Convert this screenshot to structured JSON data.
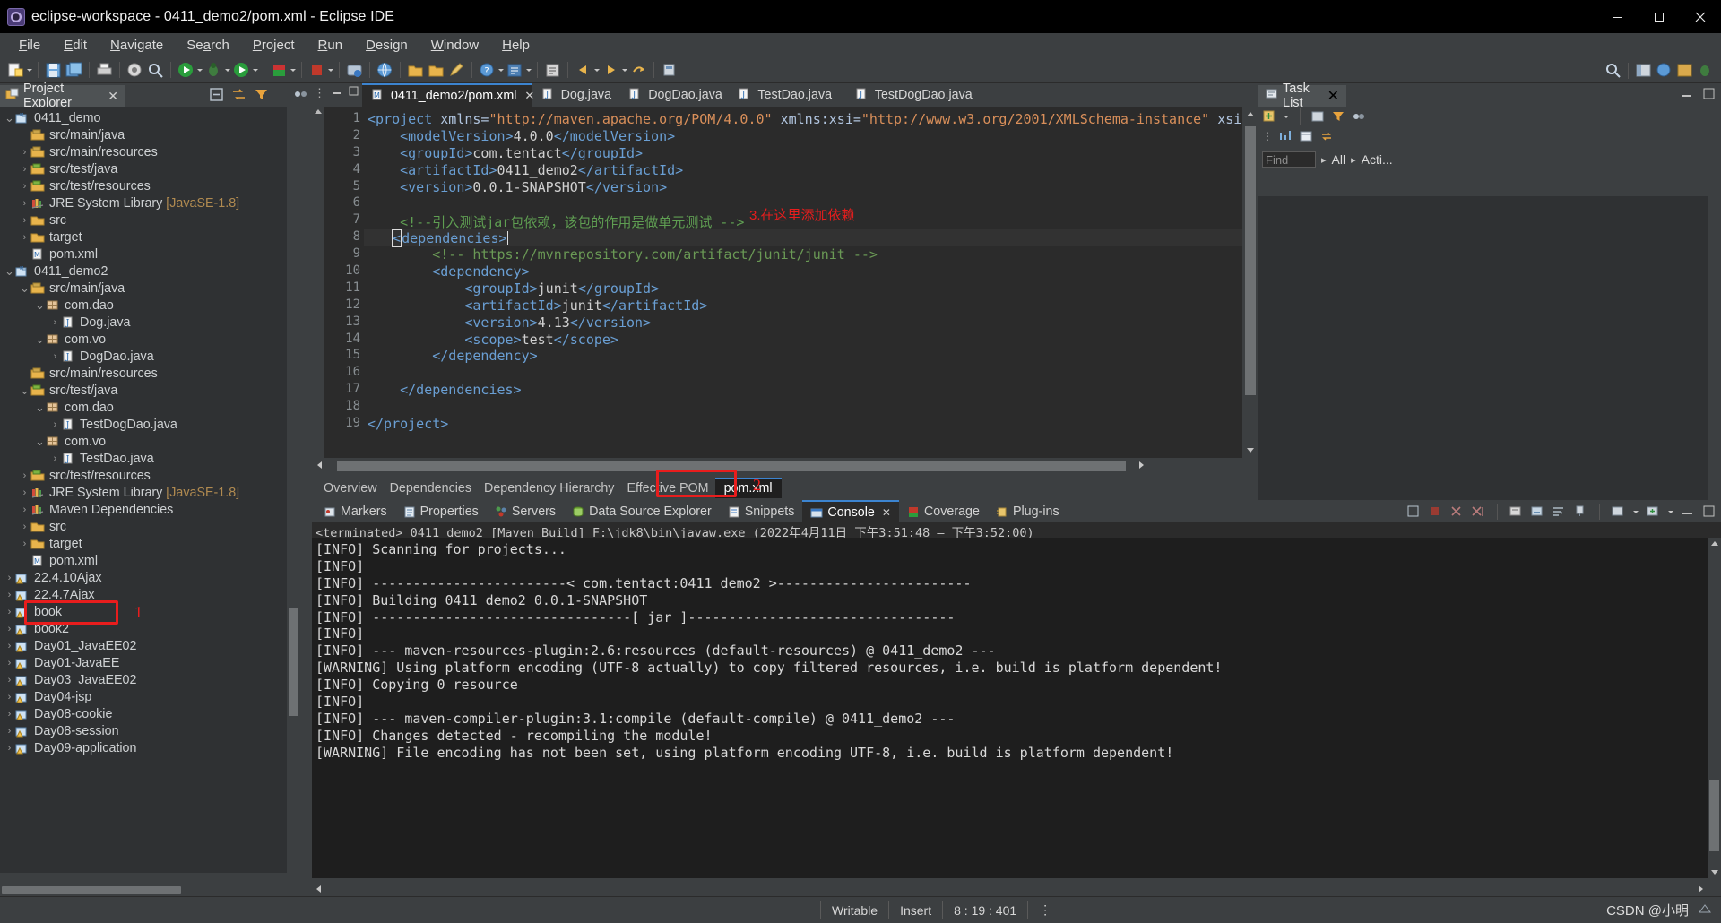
{
  "window": {
    "title": "eclipse-workspace - 0411_demo2/pom.xml - Eclipse IDE",
    "app_icon": "eclipse-icon",
    "minimize": "—",
    "maximize": "❐",
    "close": "✕"
  },
  "menubar": {
    "items": [
      {
        "label": "File",
        "mnemonic": "F"
      },
      {
        "label": "Edit",
        "mnemonic": "E"
      },
      {
        "label": "Navigate",
        "mnemonic": "N"
      },
      {
        "label": "Search",
        "mnemonic": "a"
      },
      {
        "label": "Project",
        "mnemonic": "P"
      },
      {
        "label": "Run",
        "mnemonic": "R"
      },
      {
        "label": "Design",
        "mnemonic": "D"
      },
      {
        "label": "Window",
        "mnemonic": "W"
      },
      {
        "label": "Help",
        "mnemonic": "H"
      }
    ]
  },
  "project_explorer": {
    "title": "Project Explorer",
    "close_label": "✕",
    "tools": [
      "collapse-all-icon",
      "link-with-editor-icon",
      "view-filter-icon",
      "view-menu-icon"
    ],
    "tree": [
      {
        "indent": 0,
        "twisty": "down",
        "icon": "maven-project-icon",
        "label": "0411_demo"
      },
      {
        "indent": 1,
        "twisty": "none",
        "icon": "source-folder-icon",
        "label": "src/main/java"
      },
      {
        "indent": 1,
        "twisty": "right",
        "icon": "source-folder-icon",
        "label": "src/main/resources"
      },
      {
        "indent": 1,
        "twisty": "right",
        "icon": "test-source-folder-icon",
        "label": "src/test/java"
      },
      {
        "indent": 1,
        "twisty": "right",
        "icon": "test-source-folder-icon",
        "label": "src/test/resources"
      },
      {
        "indent": 1,
        "twisty": "right",
        "icon": "library-icon",
        "label": "JRE System Library",
        "suffix": "[JavaSE-1.8]"
      },
      {
        "indent": 1,
        "twisty": "right",
        "icon": "folder-icon",
        "label": "src"
      },
      {
        "indent": 1,
        "twisty": "right",
        "icon": "folder-icon",
        "label": "target"
      },
      {
        "indent": 1,
        "twisty": "none",
        "icon": "maven-pom-icon",
        "label": "pom.xml"
      },
      {
        "indent": 0,
        "twisty": "down",
        "icon": "maven-project-icon",
        "label": "0411_demo2"
      },
      {
        "indent": 1,
        "twisty": "down",
        "icon": "source-folder-icon",
        "label": "src/main/java"
      },
      {
        "indent": 2,
        "twisty": "down",
        "icon": "package-icon",
        "label": "com.dao"
      },
      {
        "indent": 3,
        "twisty": "right",
        "icon": "java-file-icon",
        "label": "Dog.java"
      },
      {
        "indent": 2,
        "twisty": "down",
        "icon": "package-icon",
        "label": "com.vo"
      },
      {
        "indent": 3,
        "twisty": "right",
        "icon": "java-file-icon",
        "label": "DogDao.java"
      },
      {
        "indent": 1,
        "twisty": "none",
        "icon": "source-folder-icon",
        "label": "src/main/resources"
      },
      {
        "indent": 1,
        "twisty": "down",
        "icon": "test-source-folder-icon",
        "label": "src/test/java"
      },
      {
        "indent": 2,
        "twisty": "down",
        "icon": "package-icon",
        "label": "com.dao"
      },
      {
        "indent": 3,
        "twisty": "right",
        "icon": "java-file-icon",
        "label": "TestDogDao.java"
      },
      {
        "indent": 2,
        "twisty": "down",
        "icon": "package-icon",
        "label": "com.vo"
      },
      {
        "indent": 3,
        "twisty": "right",
        "icon": "java-file-icon",
        "label": "TestDao.java"
      },
      {
        "indent": 1,
        "twisty": "right",
        "icon": "test-source-folder-icon",
        "label": "src/test/resources"
      },
      {
        "indent": 1,
        "twisty": "right",
        "icon": "library-icon",
        "label": "JRE System Library",
        "suffix": "[JavaSE-1.8]"
      },
      {
        "indent": 1,
        "twisty": "right",
        "icon": "library-icon",
        "label": "Maven Dependencies"
      },
      {
        "indent": 1,
        "twisty": "right",
        "icon": "folder-icon",
        "label": "src"
      },
      {
        "indent": 1,
        "twisty": "right",
        "icon": "folder-icon",
        "label": "target"
      },
      {
        "indent": 1,
        "twisty": "none",
        "icon": "maven-pom-icon",
        "label": "pom.xml",
        "highlighted": true
      },
      {
        "indent": 0,
        "twisty": "right",
        "icon": "warn-project-icon",
        "label": "22.4.10Ajax"
      },
      {
        "indent": 0,
        "twisty": "right",
        "icon": "warn-project-icon",
        "label": "22.4.7Ajax"
      },
      {
        "indent": 0,
        "twisty": "right",
        "icon": "warn-project-icon",
        "label": "book"
      },
      {
        "indent": 0,
        "twisty": "right",
        "icon": "warn-project-icon",
        "label": "book2"
      },
      {
        "indent": 0,
        "twisty": "right",
        "icon": "warn-project-icon",
        "label": "Day01_JavaEE02"
      },
      {
        "indent": 0,
        "twisty": "right",
        "icon": "warn-project-icon",
        "label": "Day01-JavaEE"
      },
      {
        "indent": 0,
        "twisty": "right",
        "icon": "warn-project-icon",
        "label": "Day03_JavaEE02"
      },
      {
        "indent": 0,
        "twisty": "right",
        "icon": "warn-project-icon",
        "label": "Day04-jsp"
      },
      {
        "indent": 0,
        "twisty": "right",
        "icon": "warn-project-icon",
        "label": "Day08-cookie"
      },
      {
        "indent": 0,
        "twisty": "right",
        "icon": "warn-project-icon",
        "label": "Day08-session"
      },
      {
        "indent": 0,
        "twisty": "right",
        "icon": "warn-project-icon",
        "label": "Day09-application"
      }
    ]
  },
  "annotations": {
    "one": "1",
    "two": "2",
    "three": "3.在这里添加依赖"
  },
  "editor": {
    "tabs": [
      {
        "label": "0411_demo2/pom.xml",
        "icon": "maven-pom-icon",
        "active": true,
        "closable": true
      },
      {
        "label": "Dog.java",
        "icon": "java-file-icon",
        "active": false
      },
      {
        "label": "DogDao.java",
        "icon": "java-file-icon",
        "active": false
      },
      {
        "label": "TestDao.java",
        "icon": "java-file-icon",
        "active": false
      },
      {
        "label": "TestDogDao.java",
        "icon": "java-file-icon",
        "active": false
      }
    ],
    "code_lines": [
      {
        "n": "1",
        "fold": true,
        "segments": [
          {
            "t": "tag",
            "s": "<project "
          },
          {
            "t": "attr",
            "s": "xmlns="
          },
          {
            "t": "str",
            "s": "\"http://maven.apache.org/POM/4.0.0\""
          },
          {
            "t": "txt",
            "s": " "
          },
          {
            "t": "attr",
            "s": "xmlns:xsi="
          },
          {
            "t": "str",
            "s": "\"http://www.w3.org/2001/XMLSchema-instance\""
          },
          {
            "t": "txt",
            "s": " "
          },
          {
            "t": "attr",
            "s": "xsi:s"
          }
        ]
      },
      {
        "n": "2",
        "fold": false,
        "segments": [
          {
            "t": "txt",
            "s": "    "
          },
          {
            "t": "tag",
            "s": "<modelVersion>"
          },
          {
            "t": "txt",
            "s": "4.0.0"
          },
          {
            "t": "tag",
            "s": "</modelVersion>"
          }
        ]
      },
      {
        "n": "3",
        "fold": false,
        "segments": [
          {
            "t": "txt",
            "s": "    "
          },
          {
            "t": "tag",
            "s": "<groupId>"
          },
          {
            "t": "txt",
            "s": "com.tentact"
          },
          {
            "t": "tag",
            "s": "</groupId>"
          }
        ]
      },
      {
        "n": "4",
        "fold": false,
        "segments": [
          {
            "t": "txt",
            "s": "    "
          },
          {
            "t": "tag",
            "s": "<artifactId>"
          },
          {
            "t": "txt",
            "s": "0411_demo2"
          },
          {
            "t": "tag",
            "s": "</artifactId>"
          }
        ]
      },
      {
        "n": "5",
        "fold": false,
        "segments": [
          {
            "t": "txt",
            "s": "    "
          },
          {
            "t": "tag",
            "s": "<version>"
          },
          {
            "t": "txt",
            "s": "0.0.1-SNAPSHOT"
          },
          {
            "t": "tag",
            "s": "</version>"
          }
        ]
      },
      {
        "n": "6",
        "fold": false,
        "segments": []
      },
      {
        "n": "7",
        "fold": false,
        "segments": [
          {
            "t": "txt",
            "s": "    "
          },
          {
            "t": "comcn",
            "s": "<!--引入测试jar包依赖，该包的作用是做单元测试 -->"
          }
        ]
      },
      {
        "n": "8",
        "fold": true,
        "hl": true,
        "cursor": true,
        "segments": [
          {
            "t": "txt",
            "s": "   "
          },
          {
            "t": "box",
            "s": "<"
          },
          {
            "t": "tag",
            "s": "dependencies>"
          }
        ]
      },
      {
        "n": "9",
        "fold": false,
        "segments": [
          {
            "t": "txt",
            "s": "        "
          },
          {
            "t": "com",
            "s": "<!-- https://mvnrepository.com/artifact/junit/junit -->"
          }
        ]
      },
      {
        "n": "10",
        "fold": true,
        "segments": [
          {
            "t": "txt",
            "s": "        "
          },
          {
            "t": "tag",
            "s": "<dependency>"
          }
        ]
      },
      {
        "n": "11",
        "fold": false,
        "segments": [
          {
            "t": "txt",
            "s": "            "
          },
          {
            "t": "tag",
            "s": "<groupId>"
          },
          {
            "t": "txt",
            "s": "junit"
          },
          {
            "t": "tag",
            "s": "</groupId>"
          }
        ]
      },
      {
        "n": "12",
        "fold": false,
        "segments": [
          {
            "t": "txt",
            "s": "            "
          },
          {
            "t": "tag",
            "s": "<artifactId>"
          },
          {
            "t": "txt",
            "s": "junit"
          },
          {
            "t": "tag",
            "s": "</artifactId>"
          }
        ]
      },
      {
        "n": "13",
        "fold": false,
        "segments": [
          {
            "t": "txt",
            "s": "            "
          },
          {
            "t": "tag",
            "s": "<version>"
          },
          {
            "t": "txt",
            "s": "4.13"
          },
          {
            "t": "tag",
            "s": "</version>"
          }
        ]
      },
      {
        "n": "14",
        "fold": false,
        "segments": [
          {
            "t": "txt",
            "s": "            "
          },
          {
            "t": "tag",
            "s": "<scope>"
          },
          {
            "t": "txt",
            "s": "test"
          },
          {
            "t": "tag",
            "s": "</scope>"
          }
        ]
      },
      {
        "n": "15",
        "fold": false,
        "segments": [
          {
            "t": "txt",
            "s": "        "
          },
          {
            "t": "tag",
            "s": "</dependency>"
          }
        ]
      },
      {
        "n": "16",
        "fold": false,
        "segments": []
      },
      {
        "n": "17",
        "fold": false,
        "segments": [
          {
            "t": "txt",
            "s": "    "
          },
          {
            "t": "tag",
            "s": "</dependencies>"
          }
        ]
      },
      {
        "n": "18",
        "fold": false,
        "segments": []
      },
      {
        "n": "19",
        "fold": false,
        "segments": [
          {
            "t": "tag",
            "s": "</project>"
          }
        ]
      }
    ],
    "page_tabs": [
      {
        "label": "Overview",
        "selected": false
      },
      {
        "label": "Dependencies",
        "selected": false
      },
      {
        "label": "Dependency Hierarchy",
        "selected": false
      },
      {
        "label": "Effective POM",
        "selected": false
      },
      {
        "label": "pom.xml",
        "selected": true
      }
    ]
  },
  "bottom_panel": {
    "tabs": [
      {
        "label": "Markers",
        "icon": "marker-icon",
        "active": false
      },
      {
        "label": "Properties",
        "icon": "properties-icon",
        "active": false
      },
      {
        "label": "Servers",
        "icon": "servers-icon",
        "active": false
      },
      {
        "label": "Data Source Explorer",
        "icon": "datasource-icon",
        "active": false
      },
      {
        "label": "Snippets",
        "icon": "snippets-icon",
        "active": false
      },
      {
        "label": "Console",
        "icon": "console-icon",
        "active": true,
        "closable": true
      },
      {
        "label": "Coverage",
        "icon": "coverage-icon",
        "active": false
      },
      {
        "label": "Plug-ins",
        "icon": "plugins-icon",
        "active": false
      }
    ],
    "status_line": "<terminated> 0411_demo2 [Maven Build] F:\\jdk8\\bin\\javaw.exe (2022年4月11日 下午3:51:48 – 下午3:52:00)",
    "console_lines": [
      "[INFO] Scanning for projects...",
      "[INFO] ",
      "[INFO] ------------------------< com.tentact:0411_demo2 >------------------------",
      "[INFO] Building 0411_demo2 0.0.1-SNAPSHOT",
      "[INFO] --------------------------------[ jar ]---------------------------------",
      "[INFO] ",
      "[INFO] --- maven-resources-plugin:2.6:resources (default-resources) @ 0411_demo2 ---",
      "[WARNING] Using platform encoding (UTF-8 actually) to copy filtered resources, i.e. build is platform dependent!",
      "[INFO] Copying 0 resource",
      "[INFO] ",
      "[INFO] --- maven-compiler-plugin:3.1:compile (default-compile) @ 0411_demo2 ---",
      "[INFO] Changes detected - recompiling the module!",
      "[WARNING] File encoding has not been set, using platform encoding UTF-8, i.e. build is platform dependent!"
    ]
  },
  "task_list": {
    "title": "Task List",
    "close_label": "✕",
    "find_placeholder": "Find",
    "all_label": "All",
    "activate_label": "Acti...",
    "chevron": "▸"
  },
  "statusbar": {
    "writable": "Writable",
    "insert": "Insert",
    "position": "8 : 19 : 401",
    "watermark": "CSDN @小明",
    "menu_dots": "⋮"
  },
  "colors": {
    "accent": "#3c84d0",
    "annotation_red": "#e81d1d",
    "editor_bg": "#2b2b2b",
    "console_bg": "#1e1e1e",
    "chrome_bg": "#3c3f41"
  }
}
